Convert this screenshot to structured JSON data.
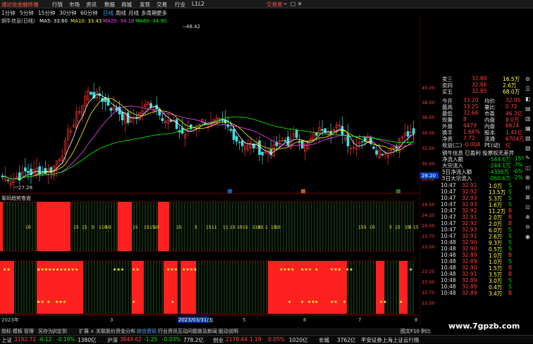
{
  "titlebar": {
    "logo": "通达信金融终端",
    "menus": [
      "行情",
      "市场",
      "资讯",
      "数据",
      "商城",
      "发现",
      "交易",
      "行业",
      "L1L2"
    ],
    "trade_label": "交易易",
    "window_buttons": [
      "─",
      "□",
      "✕"
    ]
  },
  "toolbar": {
    "periods": [
      "1分钟",
      "5分钟",
      "15分钟",
      "30分钟",
      "60分钟",
      "日线",
      "周线",
      "月线",
      "多周期",
      "更多"
    ],
    "active_period": "日线"
  },
  "main_chart": {
    "stock_line": "铜牛信息(日线)",
    "ma_labels": [
      {
        "text": "MA5: 33.60",
        "color": "#ffffff"
      },
      {
        "text": "MA10: 33.43",
        "color": "#ffff00"
      },
      {
        "text": "MA20: 34.18",
        "color": "#ff40ff"
      },
      {
        "text": "MA60: 34.90",
        "color": "#00ff00"
      }
    ],
    "high_label": "48.42",
    "low_label": "27.28",
    "y_ticks": [
      "40.00",
      "38.00",
      "36.00",
      "34.00",
      "32.00",
      "30.00",
      "28.00"
    ],
    "current_price_tag": "28.20",
    "markers": [
      "财",
      "公",
      "减"
    ]
  },
  "indicator": {
    "name": "筹码趋势卷盘",
    "y_ticks_upper": [
      "24.50",
      "24.25",
      "24.00",
      "23.75",
      "23.50",
      "23.25",
      "23.00",
      "22.75",
      "22.50"
    ],
    "upper_values": [
      "10",
      "15",
      "15",
      "5",
      "110",
      "10",
      "15",
      "15",
      "15",
      "10",
      "15",
      "5",
      "15",
      "11",
      "11",
      "15",
      "10",
      "15",
      "110",
      "15",
      "1",
      "15",
      "10",
      "15",
      "5",
      "10",
      "5",
      "15",
      "15",
      "5",
      "15"
    ],
    "lower_stars": [
      "★★",
      "★★★★★★★★★★★",
      "★★★",
      "★★",
      "★★★",
      "★★★★",
      "★★★★",
      "★★★",
      "★",
      "★★★",
      "★★",
      "★"
    ],
    "lower_stars2": [
      "★★",
      "★",
      "★★★",
      "★",
      "★",
      "★",
      "★",
      "★★",
      "★",
      "★★",
      "★",
      "★★",
      "★"
    ],
    "x_labels": [
      "2023年",
      "3",
      "2023/03/31/五",
      "5",
      "6",
      "7",
      "8"
    ]
  },
  "right_panel": {
    "asks": [
      {
        "label": "卖三",
        "price": "32.88",
        "vol": "16.5万"
      },
      {
        "label": "卖四",
        "price": "32.86",
        "vol": "2.6万"
      },
      {
        "label": "买五",
        "price": "32.85",
        "vol": "68.0万"
      }
    ],
    "quote": [
      {
        "l1": "今开",
        "v1": "33.20",
        "l2": "均价",
        "v2": "32.95"
      },
      {
        "l1": "最高",
        "v1": "33.25",
        "l2": "量比",
        "v2": "0.72"
      },
      {
        "l1": "最低",
        "v1": "32.66",
        "l2": "市盈",
        "v2": "46.3亿"
      },
      {
        "l1": "现量",
        "v1": "8",
        "l2": "内盘",
        "v2": "8.0万"
      },
      {
        "l1": "外盘",
        "v1": "4479",
        "l2": "内盘",
        "v2": "6624"
      },
      {
        "l1": "换手",
        "v1": "1.66%",
        "l2": "股本",
        "v2": "1.41亿"
      },
      {
        "l1": "净资",
        "v1": "7.72",
        "l2": "流通",
        "v2": "6704万"
      },
      {
        "l1": "收益(二)",
        "v1": "-0.004",
        "l2": "PE(动)",
        "v2": "亿"
      }
    ],
    "info_line": "铜牛信息 已盈利 投票权无差异",
    "flows": [
      {
        "label": "净流入额",
        "value": "-544.6万",
        "pct": "-15%"
      },
      {
        "label": "大宗流入",
        "value": "-244.1万",
        "pct": "-7%"
      },
      {
        "label": "5日净流入额",
        "value": "-4336万",
        "pct": "-6%"
      },
      {
        "label": "5日大宗流入",
        "value": "-060.6万",
        "pct": "-2%"
      }
    ],
    "ticks": [
      {
        "time": "10:47",
        "price": "32.91",
        "vol": "1.0万",
        "flag": "S"
      },
      {
        "time": "10:47",
        "price": "32.92",
        "vol": "13.5万",
        "flag": "S"
      },
      {
        "time": "10:47",
        "price": "32.93",
        "vol": "5.3万",
        "flag": "S"
      },
      {
        "time": "10:47",
        "price": "32.93",
        "vol": "1.6万",
        "flag": "S"
      },
      {
        "time": "10:47",
        "price": "32.92",
        "vol": "11.2万",
        "flag": "B"
      },
      {
        "time": "10:47",
        "price": "32.91",
        "vol": "2.0万",
        "flag": "B"
      },
      {
        "time": "10:47",
        "price": "32.92",
        "vol": "2.0万",
        "flag": "B"
      },
      {
        "time": "10:47",
        "price": "32.93",
        "vol": "6.0万",
        "flag": "S"
      },
      {
        "time": "10:47",
        "price": "32.91",
        "vol": "2.6万",
        "flag": "S"
      },
      {
        "time": "10:48",
        "price": "32.90",
        "vol": "9.3万",
        "flag": "S"
      },
      {
        "time": "10:48",
        "price": "32.90",
        "vol": "0.5万",
        "flag": "S"
      },
      {
        "time": "10:48",
        "price": "32.89",
        "vol": "1.0万",
        "flag": "B"
      },
      {
        "time": "10:48",
        "price": "32.89",
        "vol": "1.0万",
        "flag": "S"
      },
      {
        "time": "10:48",
        "price": "32.90",
        "vol": "1.5万",
        "flag": "B"
      },
      {
        "time": "10:48",
        "price": "32.91",
        "vol": "3.5万",
        "flag": "B"
      },
      {
        "time": "10:48",
        "price": "32.89",
        "vol": "3.0万",
        "flag": "S"
      },
      {
        "time": "10:48",
        "price": "32.89",
        "vol": "0.4万",
        "flag": "S"
      },
      {
        "time": "10:48",
        "price": "32.89",
        "vol": "3.4万",
        "flag": "B"
      }
    ]
  },
  "bottom_tabs": [
    "指标",
    "模板",
    "管理",
    "另存为",
    "训定到",
    "扩展 ∧",
    "关联股价",
    "资金分布",
    "综合资讯",
    "行业资讯",
    "互动问题",
    "普及新闻",
    "股动说明"
  ],
  "bottom_active_tab": "综合资讯",
  "bottom_right_label": "图文F10 例比",
  "statusbar": [
    {
      "name": "上证",
      "value": "3192.72",
      "chg": "-6.12",
      "pct": "-0.19%",
      "amt": "1380亿"
    },
    {
      "name": "沪深",
      "value": "3849.62",
      "chg": "-1.25",
      "pct": "-0.03%",
      "amt": "778.2亿"
    },
    {
      "name": "创业",
      "value": "2178.44",
      "chg": "1.19",
      "pct": "0.05%",
      "amt": "1020亿"
    }
  ],
  "status_tail": [
    "长城",
    "3762亿",
    "平安证券上海上证云行情"
  ],
  "watermark": "www.7gpzb.com",
  "right_strip_icons": [
    "⚙",
    "☰",
    "◧",
    "▤",
    "▥",
    "▦",
    "▧",
    "▨",
    "✎",
    "◫",
    "⊞",
    "⊟",
    "⊠",
    "⊡",
    "⊕",
    "⊖",
    "◉"
  ],
  "colors": {
    "red": "#ff2020",
    "green": "#00c000",
    "cyan": "#40e0e0",
    "ma5": "#ffffff",
    "ma10": "#ffff00",
    "ma20": "#ff40ff",
    "ma60": "#00ff00"
  }
}
